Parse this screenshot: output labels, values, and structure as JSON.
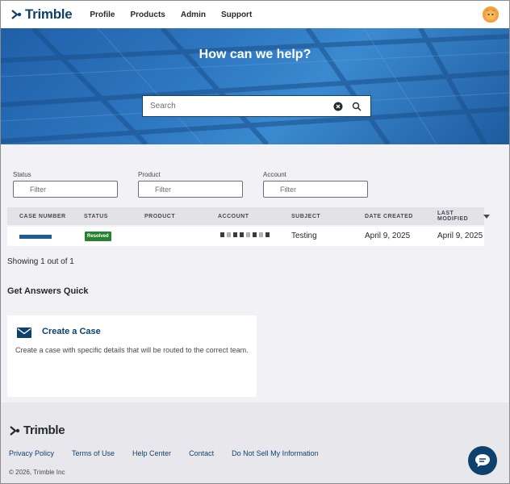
{
  "header": {
    "logo_text": "Trimble",
    "nav": [
      "Profile",
      "Products",
      "Admin",
      "Support"
    ]
  },
  "hero": {
    "title": "How can we help?",
    "search_placeholder": "Search"
  },
  "filters": [
    {
      "label": "Status",
      "placeholder": "Filter"
    },
    {
      "label": "Product",
      "placeholder": "Filter"
    },
    {
      "label": "Account",
      "placeholder": "Filter"
    }
  ],
  "table": {
    "columns": [
      "CASE NUMBER",
      "STATUS",
      "PRODUCT",
      "ACCOUNT",
      "SUBJECT",
      "DATE CREATED",
      "LAST MODIFIED"
    ],
    "rows": [
      {
        "status": "Resolved",
        "subject": "Testing",
        "date_created": "April 9, 2025",
        "last_modified": "April 9, 2025"
      }
    ],
    "showing": "Showing 1 out of 1"
  },
  "quick": {
    "title": "Get Answers Quick",
    "card_title": "Create a Case",
    "card_text": "Create a case with specific details that will be routed to the correct team."
  },
  "footer": {
    "logo_text": "Trimble",
    "links": [
      "Privacy Policy",
      "Terms of Use",
      "Help Center",
      "Contact",
      "Do Not Sell My Information"
    ],
    "copyright": "© 2026, Trimble Inc"
  },
  "colors": {
    "brand": "#0e416c",
    "hero": "#2f79c2",
    "resolved": "#27822e"
  }
}
